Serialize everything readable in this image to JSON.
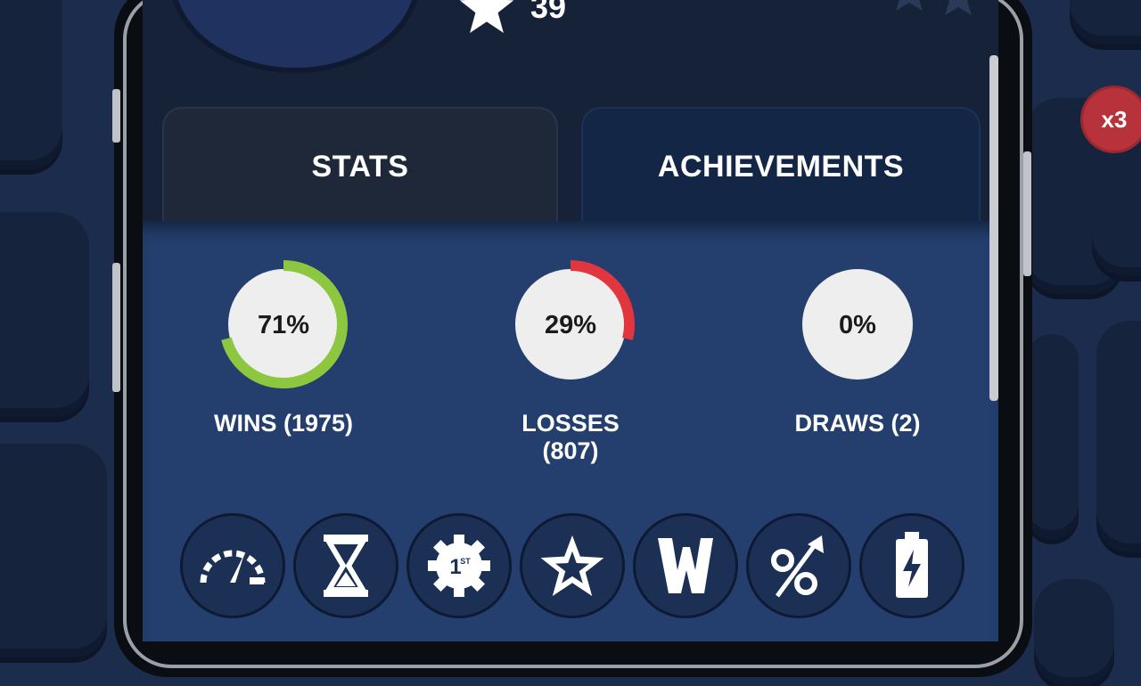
{
  "player": {
    "star_count": "39"
  },
  "tabs": [
    {
      "label": "STATS",
      "active": true
    },
    {
      "label": "ACHIEVEMENTS",
      "active": false
    }
  ],
  "stats": [
    {
      "percent_label": "71%",
      "fraction": 0.71,
      "label": "WINS (1975)",
      "color": "#8dc63f"
    },
    {
      "percent_label": "29%",
      "fraction": 0.29,
      "label": "LOSSES (807)",
      "color": "#e2363e"
    },
    {
      "percent_label": "0%",
      "fraction": 0.0,
      "label": "DRAWS (2)",
      "color": "#aaaaaa"
    }
  ],
  "achievement_icons": [
    "speedometer-icon",
    "hourglass-icon",
    "gear-first-place-icon",
    "star-icon",
    "w-letter-icon",
    "percent-up-icon",
    "battery-charge-icon"
  ],
  "background": {
    "badge_text": "x3"
  },
  "colors": {
    "ring_track": "#eeeeee",
    "panel": "#243f6e",
    "background": "#1c2c4c"
  }
}
